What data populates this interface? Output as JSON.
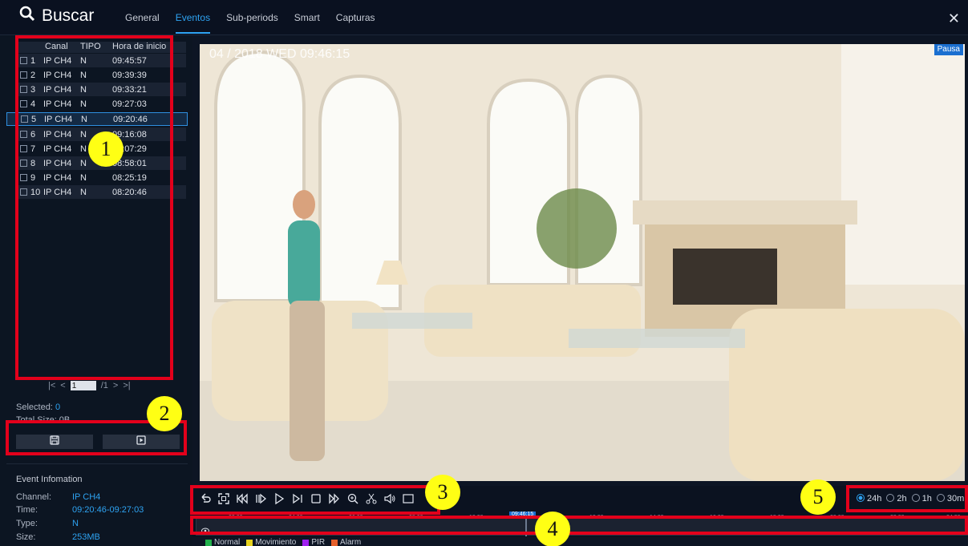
{
  "header": {
    "title": "Buscar",
    "tabs": [
      "General",
      "Eventos",
      "Sub-periods",
      "Smart",
      "Capturas"
    ],
    "active_tab": "Eventos"
  },
  "table": {
    "columns": [
      "Canal",
      "TIPO",
      "Hora de inicio"
    ],
    "rows": [
      {
        "no": "1",
        "canal": "IP CH4",
        "tipo": "N",
        "hora": "09:45:57"
      },
      {
        "no": "2",
        "canal": "IP CH4",
        "tipo": "N",
        "hora": "09:39:39"
      },
      {
        "no": "3",
        "canal": "IP CH4",
        "tipo": "N",
        "hora": "09:33:21"
      },
      {
        "no": "4",
        "canal": "IP CH4",
        "tipo": "N",
        "hora": "09:27:03"
      },
      {
        "no": "5",
        "canal": "IP CH4",
        "tipo": "N",
        "hora": "09:20:46"
      },
      {
        "no": "6",
        "canal": "IP CH4",
        "tipo": "N",
        "hora": "09:16:08"
      },
      {
        "no": "7",
        "canal": "IP CH4",
        "tipo": "N",
        "hora": "09:07:29"
      },
      {
        "no": "8",
        "canal": "IP CH4",
        "tipo": "N",
        "hora": "08:58:01"
      },
      {
        "no": "9",
        "canal": "IP CH4",
        "tipo": "N",
        "hora": "08:25:19"
      },
      {
        "no": "10",
        "canal": "IP CH4",
        "tipo": "N",
        "hora": "08:20:46"
      }
    ],
    "selected_row": 5
  },
  "pager": {
    "page": "1",
    "total": "/1"
  },
  "selection": {
    "selected_label": "Selected:",
    "selected_value": "0",
    "size_label": "Total Size: 0B"
  },
  "event_info": {
    "title": "Event Infomation",
    "channel_label": "Channel:",
    "channel": "IP CH4",
    "time_label": "Time:",
    "time": "09:20:46-09:27:03",
    "type_label": "Type:",
    "type": "N",
    "size_label": "Size:",
    "size": "253MB"
  },
  "video": {
    "osd": "04 / 2018   WED 09:46:15",
    "status": "Pausa"
  },
  "ranges": [
    {
      "label": "24h",
      "selected": true
    },
    {
      "label": "2h",
      "selected": false
    },
    {
      "label": "1h",
      "selected": false
    },
    {
      "label": "30m",
      "selected": false
    }
  ],
  "timeline": {
    "labels": [
      "02:00",
      "04:00",
      "06:00",
      "08:00",
      "10:00",
      "12:00",
      "14:00",
      "16:00",
      "18:00",
      "20:00",
      "22:00",
      "24:00"
    ],
    "current": "09:46:15"
  },
  "legend": [
    {
      "label": "Normal",
      "color": "#22b14c"
    },
    {
      "label": "Movimiento",
      "color": "#e6d21e"
    },
    {
      "label": "PIR",
      "color": "#a020f0"
    },
    {
      "label": "Alarm",
      "color": "#e5602b"
    }
  ],
  "markers": [
    "1",
    "2",
    "3",
    "4",
    "5"
  ],
  "colors": {
    "accent": "#2ea3f2",
    "annotation_red": "#e3001b",
    "marker_yellow": "#ffff14"
  }
}
